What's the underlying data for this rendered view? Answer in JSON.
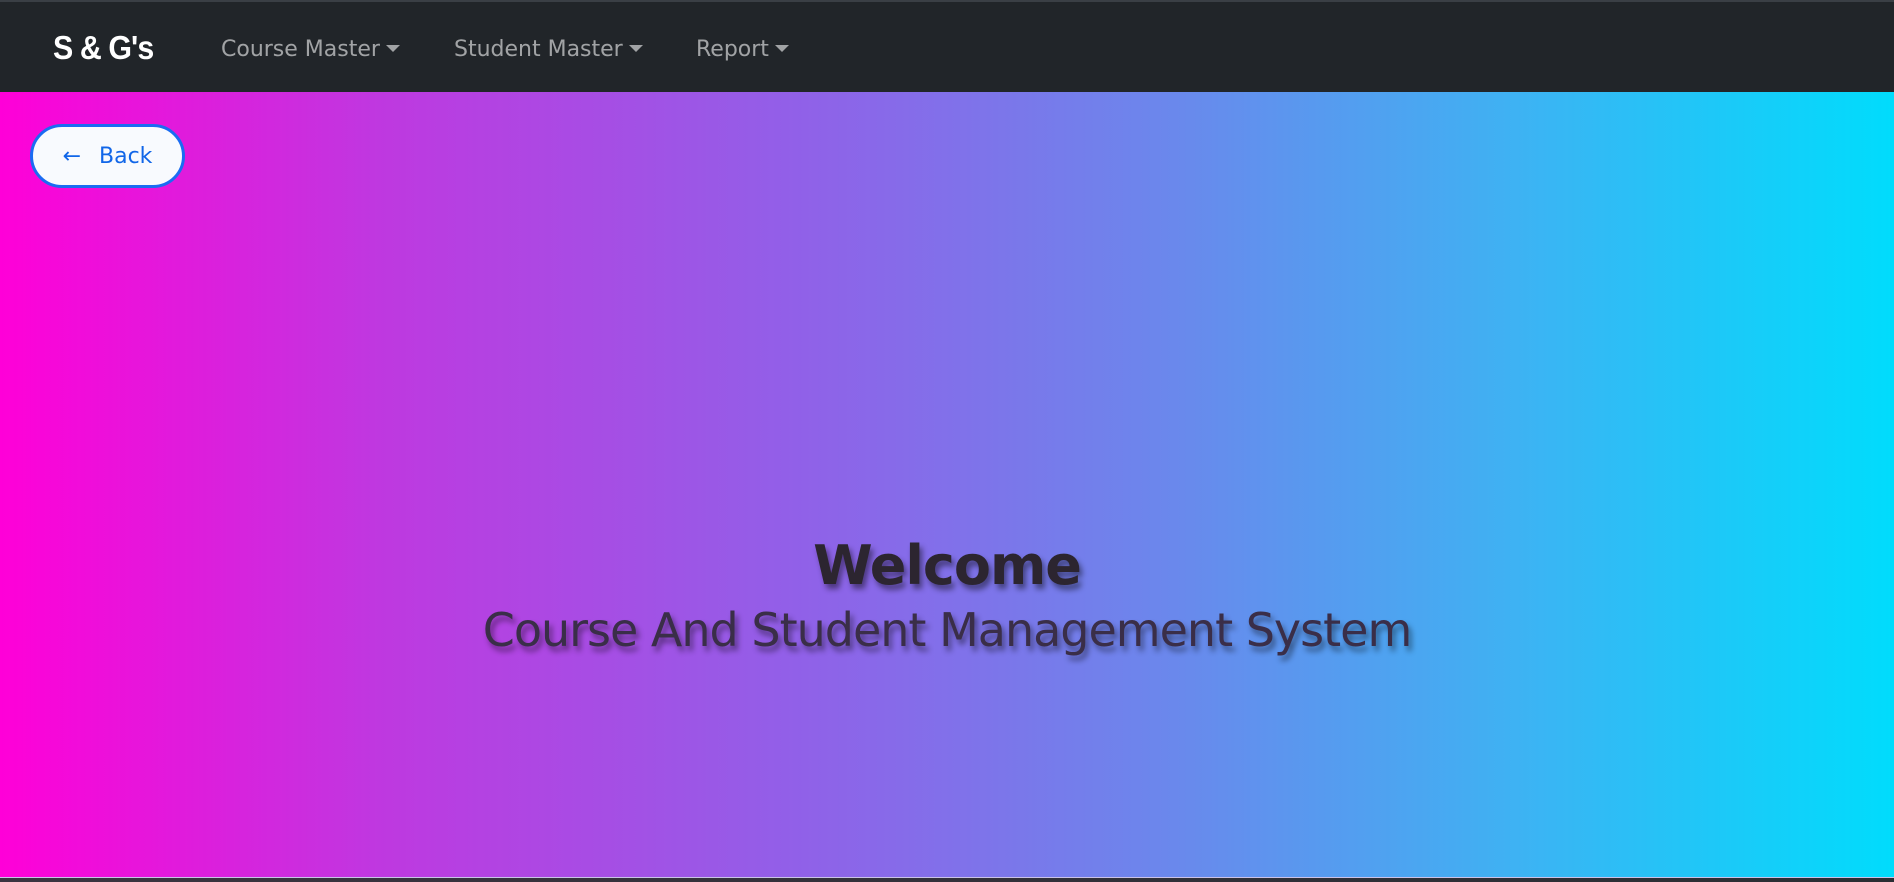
{
  "navbar": {
    "brand": "S & G's",
    "items": [
      {
        "label": "Course Master"
      },
      {
        "label": "Student Master"
      },
      {
        "label": "Report"
      }
    ]
  },
  "back_button": {
    "arrow": "←",
    "label": "Back"
  },
  "hero": {
    "title": "Welcome",
    "subtitle": "Course And Student Management System"
  },
  "colors": {
    "navbar_bg": "#212529",
    "gradient_start": "#ff00d8",
    "gradient_end": "#00dcfc",
    "accent": "#1a6cf2"
  }
}
